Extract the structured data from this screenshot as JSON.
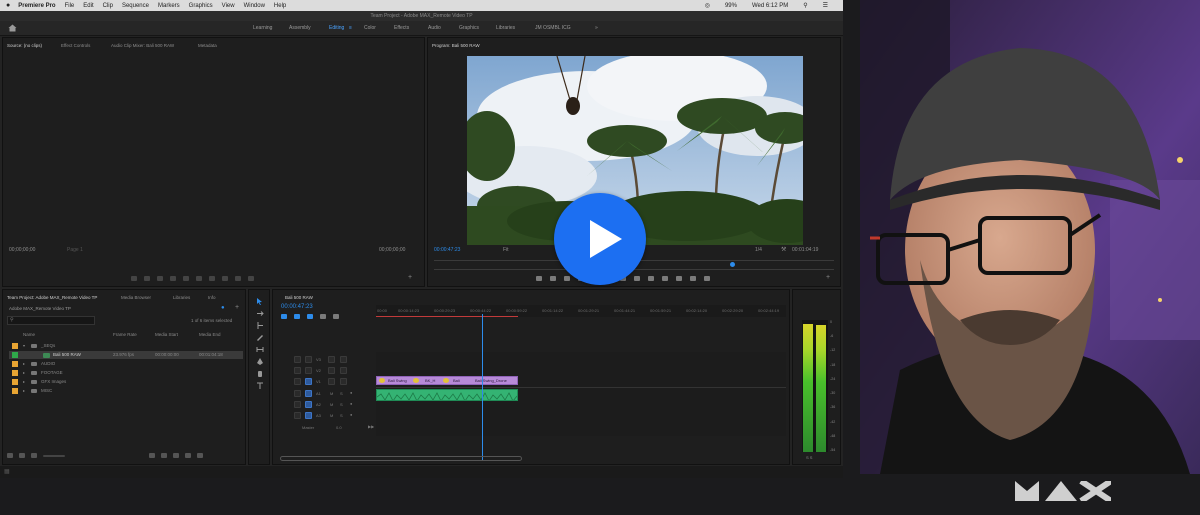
{
  "mac_menubar": {
    "apple": "",
    "app_name": "Premiere Pro",
    "menus": [
      "File",
      "Edit",
      "Clip",
      "Sequence",
      "Markers",
      "Graphics",
      "View",
      "Window",
      "Help"
    ],
    "battery": "99%",
    "clock": "Wed 6:12 PM"
  },
  "window": {
    "title": "Team Project - Adobe MAX_Remote Video TP"
  },
  "workspaces": {
    "tabs": [
      "Learning",
      "Assembly",
      "Editing",
      "Color",
      "Effects",
      "Audio",
      "Graphics",
      "Libraries",
      "JM OSMBL ICG"
    ],
    "active": "Editing"
  },
  "source_panel": {
    "tabs": [
      "Source: (no clips)",
      "Effect Controls",
      "Audio Clip Mixer: Bali 500 RAW",
      "Metadata"
    ],
    "timecode_in": "00;00;00;00",
    "fit": "Page 1",
    "timecode_out": "00;00;00;00"
  },
  "program_panel": {
    "title": "Program: Bali 500 RAW",
    "timecode": "00:00:47:23",
    "fit": "Fit",
    "quality": "1/4",
    "duration": "00:01:04:19"
  },
  "project_panel": {
    "tabs": [
      "Team Project: Adobe MAX_Remote Video TP",
      "Media Browser",
      "Libraries",
      "Info"
    ],
    "project_name": "Adobe MAX_Remote Video TP",
    "selection_info": "1 of 6 items selected",
    "columns": [
      "Name",
      "Frame Rate",
      "Media Start",
      "Media End"
    ],
    "rows": [
      {
        "name": "_SEQs",
        "frame_rate": "",
        "media_start": "",
        "media_end": ""
      },
      {
        "name": "Bali 500 RAW",
        "frame_rate": "23.976 fps",
        "media_start": "00:00:00:00",
        "media_end": "00:01:04:18"
      },
      {
        "name": "AUDIO",
        "frame_rate": "",
        "media_start": "",
        "media_end": ""
      },
      {
        "name": "FOOTAGE",
        "frame_rate": "",
        "media_start": "",
        "media_end": ""
      },
      {
        "name": "GFX Images",
        "frame_rate": "",
        "media_start": "",
        "media_end": ""
      },
      {
        "name": "MISC",
        "frame_rate": "",
        "media_start": "",
        "media_end": ""
      }
    ]
  },
  "timeline": {
    "sequence_tab": "Bali 500 RAW",
    "timecode": "00:00:47:23",
    "ruler_labels": [
      "00:00",
      "00:00:14:23",
      "00:00:29:23",
      "00:00:44:22",
      "00:00:59:22",
      "00:01:14:22",
      "00:01:29:21",
      "00:01:44:21",
      "00:01:59:21",
      "00:02:14:20",
      "00:02:29:20",
      "00:02:44:19"
    ],
    "tracks_video": [
      "V3",
      "V2",
      "V1"
    ],
    "tracks_audio": [
      "A1",
      "A2",
      "A3"
    ],
    "master_label": "Master",
    "master_value": "0.0",
    "clip_labels": [
      "Bali Swing",
      "BK_H",
      "Bali",
      "Bali Swing_Drone"
    ],
    "playhead_fraction": 0.259
  },
  "audio_meter": {
    "scale": [
      "0",
      "-6",
      "-12",
      "-18",
      "-24",
      "-30",
      "-36",
      "-42",
      "-48",
      "-54"
    ],
    "footer": "S S",
    "levels": [
      0.97,
      0.96
    ]
  },
  "video_player": {
    "play_icon": "play-icon"
  },
  "branding": {
    "logo": "MAX"
  },
  "colors": {
    "play_button": "#1c6ff2",
    "accent_blue": "#2d8ceb",
    "clip_video": "#b78ad8",
    "clip_audio": "#34b373"
  }
}
